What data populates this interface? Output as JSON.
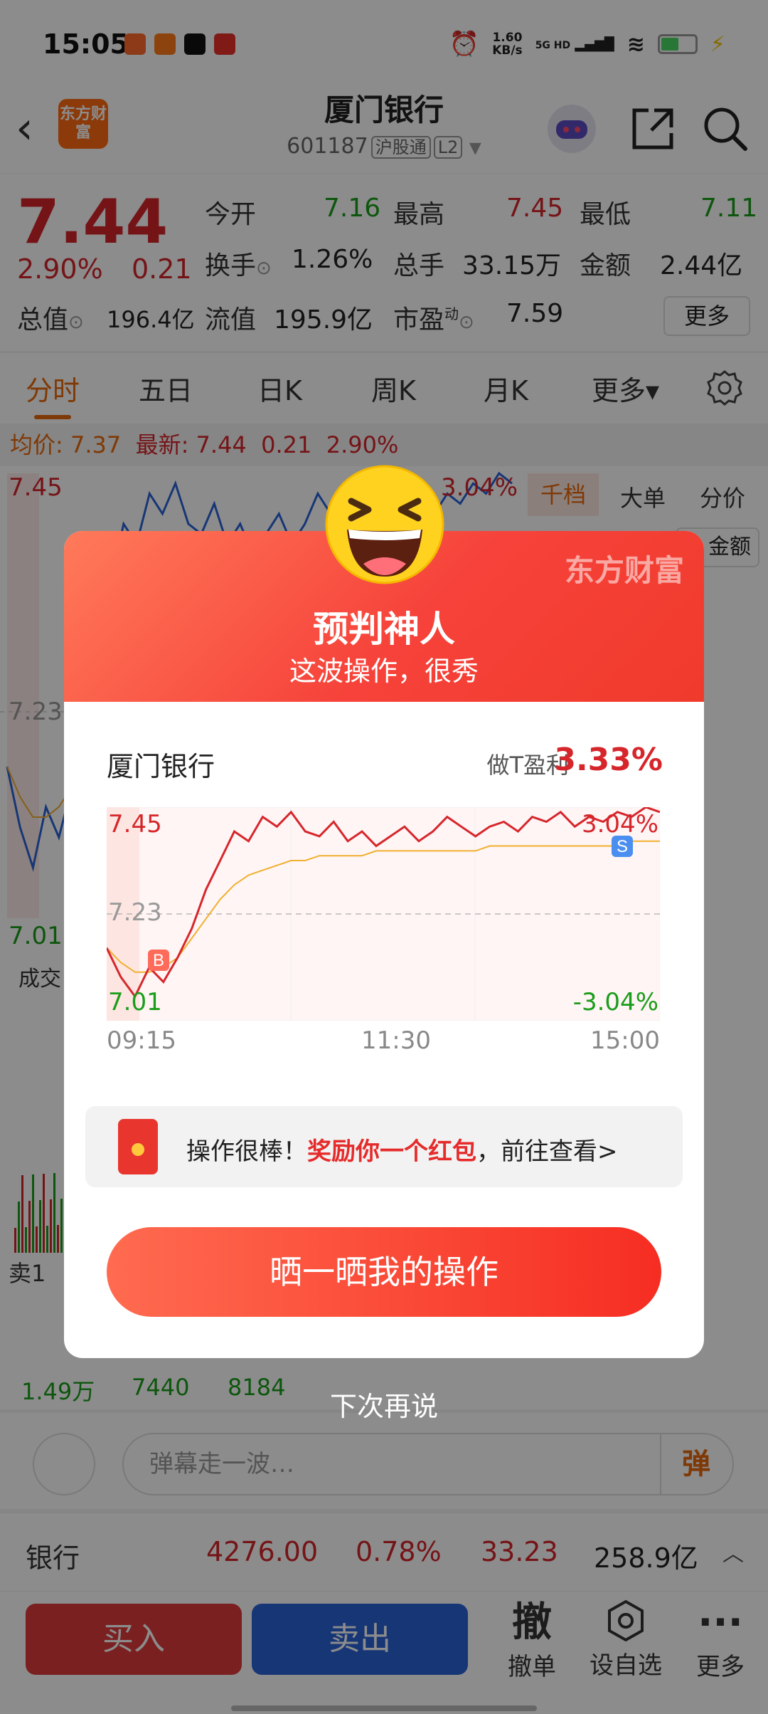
{
  "status_bar": {
    "time": "15:05",
    "net_speed_value": "1.60",
    "net_speed_unit": "KB/s",
    "network": "5G HD"
  },
  "header": {
    "logo_text": "东方财富",
    "title": "厦门银行",
    "code": "601187",
    "market_tag": "沪股通",
    "level_tag": "L2"
  },
  "quote": {
    "price": "7.44",
    "pct": "2.90%",
    "change": "0.21",
    "open_label": "今开",
    "open": "7.16",
    "high_label": "最高",
    "high": "7.45",
    "low_label": "最低",
    "low": "7.11",
    "turnover_label": "换手",
    "turnover": "1.26%",
    "volume_label": "总手",
    "volume": "33.15万",
    "amount_label": "金额",
    "amount": "2.44亿",
    "total_cap_label": "总值",
    "total_cap": "196.4亿",
    "float_cap_label": "流值",
    "float_cap": "195.9亿",
    "pe_label": "市盈",
    "pe_sup": "动",
    "pe": "7.59",
    "more_label": "更多"
  },
  "tabs": [
    "分时",
    "五日",
    "日K",
    "周K",
    "月K",
    "更多▾"
  ],
  "info_line": {
    "avg_label": "均价:",
    "avg": "7.37",
    "latest_label": "最新:",
    "latest": "7.44",
    "change": "0.21",
    "pct": "2.90%"
  },
  "background_chart": {
    "high_label": "7.45",
    "mid_label": "7.23",
    "low_label": "7.01",
    "pct_label": "3.04%",
    "volume_label": "成交"
  },
  "right_panel": {
    "tabs": [
      "千档",
      "大单",
      "分价"
    ],
    "amount_header": "金额"
  },
  "orders": {
    "sell1": "卖1",
    "row_1_values": [
      "1.49万",
      "7440",
      "8184"
    ]
  },
  "danmaku": {
    "placeholder": "弹幕走一波…",
    "button": "弹"
  },
  "sector": {
    "name": "银行",
    "index": "4276.00",
    "pct": "0.78%",
    "change": "33.23",
    "amount": "258.9亿"
  },
  "actions": {
    "buy": "买入",
    "sell": "卖出",
    "cancel_icon": "撤",
    "cancel": "撤单",
    "watch": "设自选",
    "more": "更多"
  },
  "modal": {
    "watermark": "东方财富",
    "title": "预判神人",
    "subtitle": "这波操作，很秀",
    "stock_name": "厦门银行",
    "profit_label": "做T盈利",
    "profit_value": "3.33%",
    "chart_labels": {
      "top_left": "7.45",
      "mid_left": "7.23",
      "bottom_left": "7.01",
      "top_right": "3.04%",
      "bottom_right": "-3.04%",
      "buy_marker": "B",
      "sell_marker": "S"
    },
    "times": [
      "09:15",
      "11:30",
      "15:00"
    ],
    "reward_prefix": "操作很棒！",
    "reward_highlight": "奖励你一个红包",
    "reward_suffix": "，前往查看>",
    "share_button": "晒一晒我的操作",
    "dismiss": "下次再说"
  },
  "colors": {
    "up": "#d6262b",
    "down": "#1a9d1a",
    "accent": "#e8690c",
    "buy": "#e03b3b",
    "sell": "#2a63d8"
  },
  "chart_data": {
    "type": "line",
    "x_ticks": [
      "09:15",
      "11:30",
      "15:00"
    ],
    "ylim": [
      7.01,
      7.45
    ],
    "baseline": 7.23,
    "pct_range": [
      "-3.04%",
      "3.04%"
    ],
    "series": [
      {
        "name": "",
        "kind": "price",
        "values": [
          7.16,
          7.1,
          7.06,
          7.12,
          7.09,
          7.14,
          7.2,
          7.28,
          7.34,
          7.4,
          7.38,
          7.43,
          7.41,
          7.44,
          7.4,
          7.39,
          7.42,
          7.38,
          7.4,
          7.37,
          7.39,
          7.41,
          7.38,
          7.4,
          7.43,
          7.41,
          7.39,
          7.41,
          7.42,
          7.4,
          7.43,
          7.42,
          7.44,
          7.41,
          7.43,
          7.42,
          7.44,
          7.43,
          7.45,
          7.44
        ]
      },
      {
        "name": "",
        "kind": "avg",
        "values": [
          7.16,
          7.13,
          7.11,
          7.11,
          7.12,
          7.14,
          7.18,
          7.22,
          7.26,
          7.29,
          7.31,
          7.32,
          7.33,
          7.34,
          7.34,
          7.35,
          7.35,
          7.35,
          7.35,
          7.36,
          7.36,
          7.36,
          7.36,
          7.36,
          7.36,
          7.36,
          7.36,
          7.37,
          7.37,
          7.37,
          7.37,
          7.37,
          7.37,
          7.37,
          7.37,
          7.37,
          7.37,
          7.38,
          7.38,
          7.38
        ]
      }
    ]
  }
}
